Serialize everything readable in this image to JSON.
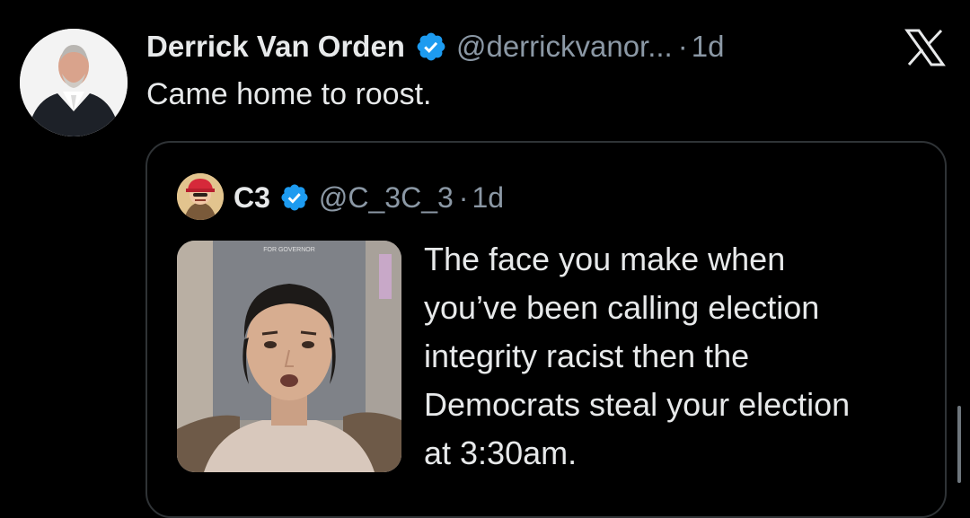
{
  "tweet": {
    "author_name": "Derrick Van Orden",
    "handle": "@derrickvanor...",
    "separator": "·",
    "time": "1d",
    "text": "Came home to roost.",
    "avatar_icon": "avatar-portrait",
    "verified_icon": "verified-badge-icon"
  },
  "quote": {
    "author_name": "C3",
    "handle": "@C_3C_3",
    "separator": "·",
    "time": "1d",
    "text_lines": [
      "The face you make when",
      "you’ve been calling election",
      "integrity racist then the",
      "Democrats steal your election",
      "at 3:30am."
    ],
    "media_caption": "FOR GOVERNOR"
  },
  "brand": {
    "logo_icon": "x-logo-icon"
  },
  "colors": {
    "background": "#000000",
    "primary_text": "#e7e9ea",
    "secondary_text": "#8b98a5",
    "verified_blue": "#1d9bf0",
    "card_border": "#2f3336"
  }
}
